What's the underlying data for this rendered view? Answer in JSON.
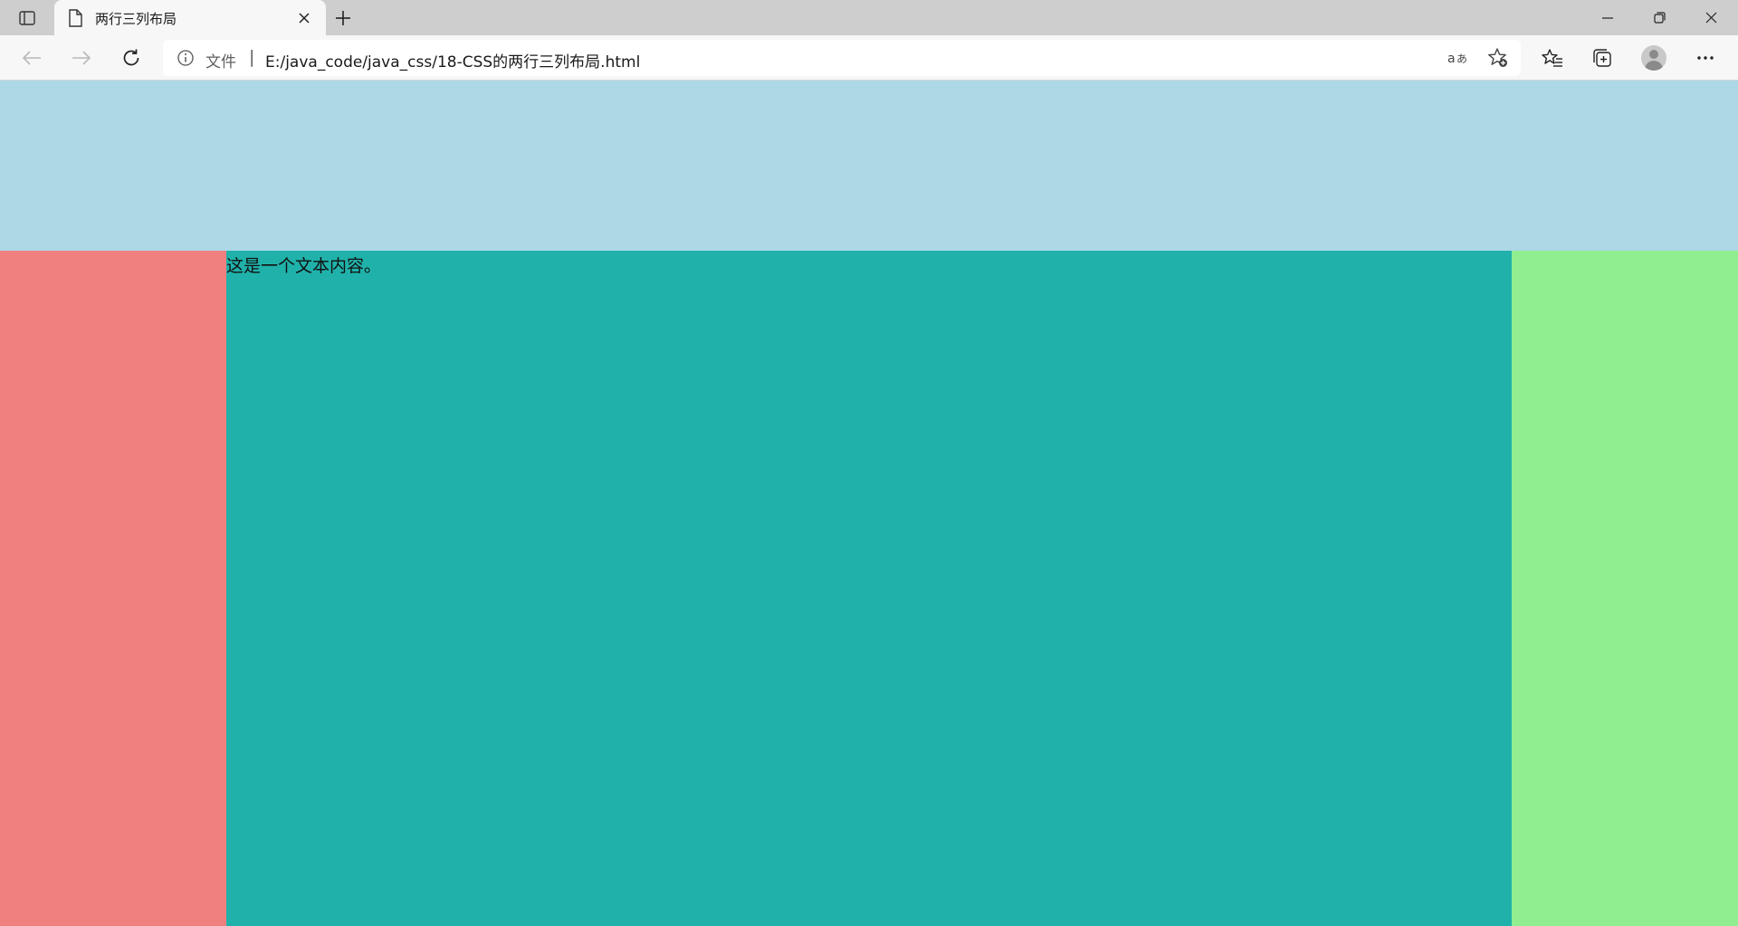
{
  "browser": {
    "tab": {
      "title": "两行三列布局",
      "favicon": "page-icon",
      "close_icon": "close-icon"
    },
    "new_tab_icon": "plus-icon",
    "window_controls": [
      "minimize-icon",
      "restore-icon",
      "close-icon"
    ],
    "toolbar": {
      "back_icon": "arrow-left-icon",
      "forward_icon": "arrow-right-icon",
      "refresh_icon": "refresh-icon",
      "favorites_icon": "favorites-list-icon",
      "collections_icon": "collections-icon",
      "profile_icon": "avatar",
      "more_icon": "more-icon"
    },
    "address_bar": {
      "info_icon": "info-icon",
      "scheme_label": "文件",
      "separator": "|",
      "url": "E:/java_code/java_css/18-CSS的两行三列布局.html",
      "translate_icon": "translate-icon",
      "add_favorite_icon": "star-add-icon"
    }
  },
  "page": {
    "colors": {
      "top_row": "#add8e6",
      "left_column": "#f08080",
      "middle_column": "#20b2aa",
      "right_column": "#90ee90"
    },
    "middle_text": "这是一个文本内容。"
  }
}
